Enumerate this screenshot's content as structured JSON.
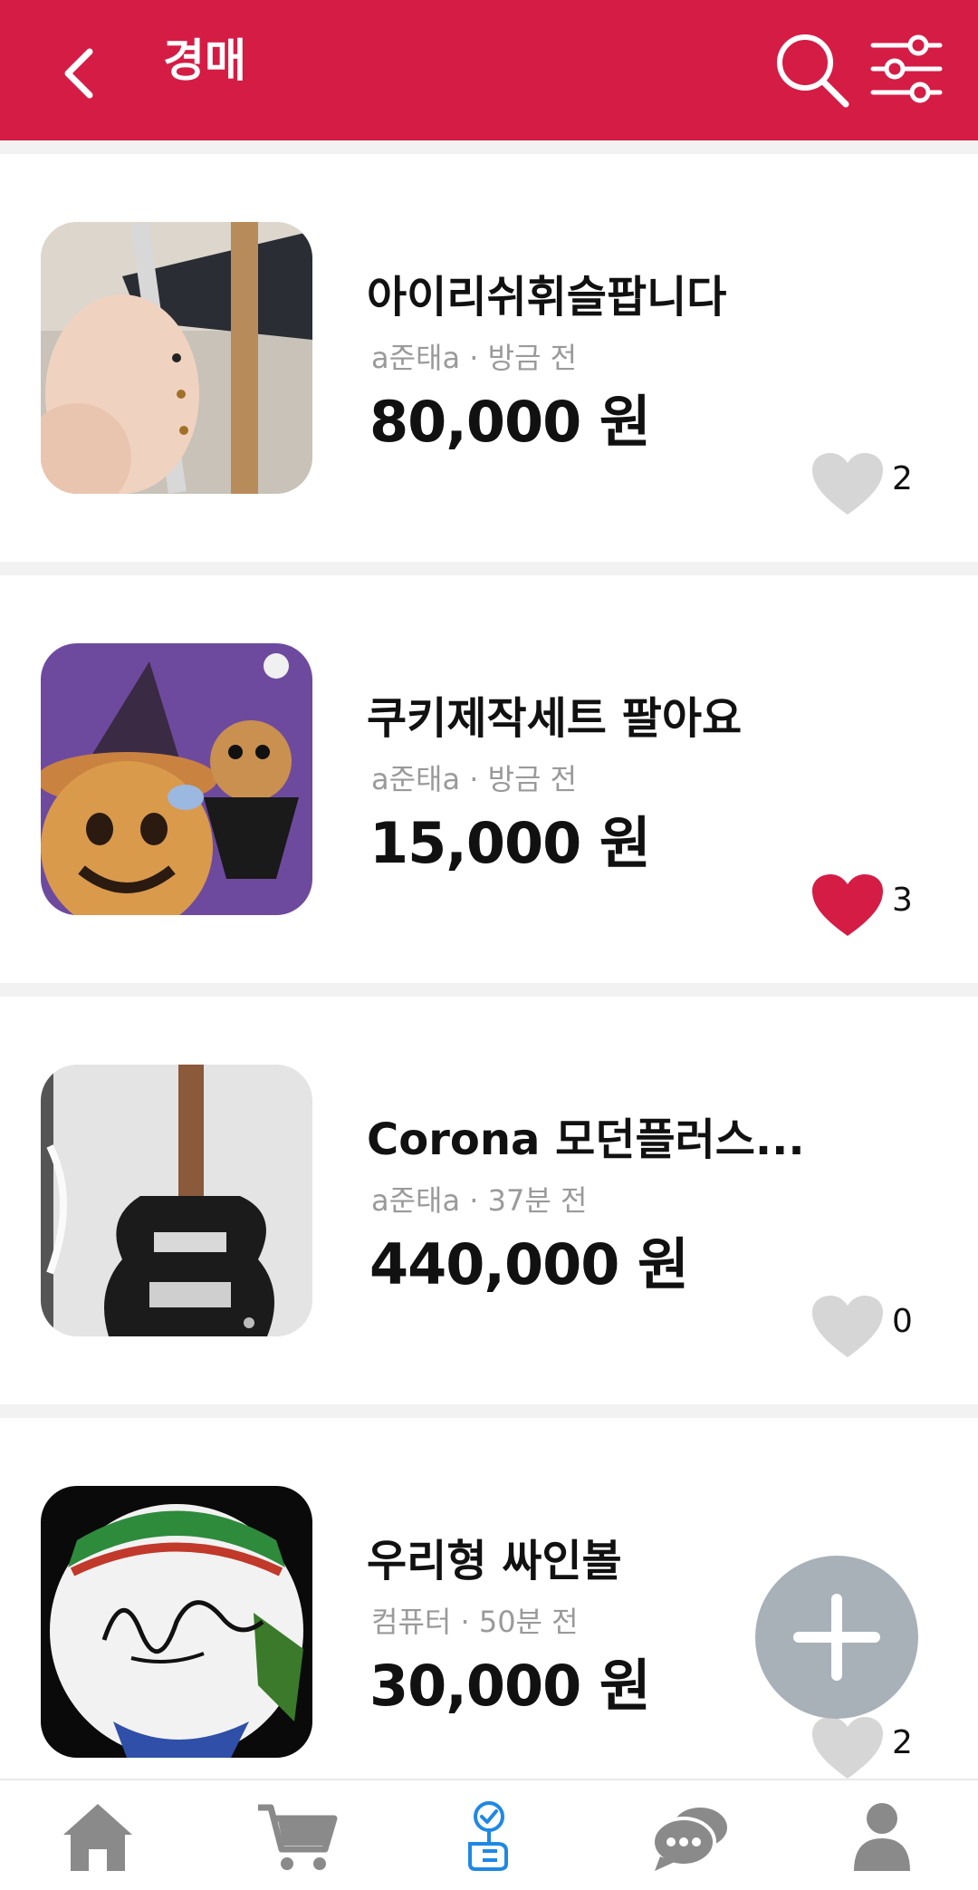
{
  "header": {
    "title": "경매",
    "back_icon": "chevron-left-icon",
    "search_icon": "search-icon",
    "filter_icon": "sliders-icon"
  },
  "items": [
    {
      "title": "아이리쉬휘슬팝니다",
      "meta": "a준태a · 방금 전",
      "price": "80,000 원",
      "likes": "2",
      "liked": false
    },
    {
      "title": "쿠키제작세트 팔아요",
      "meta": "a준태a · 방금 전",
      "price": "15,000 원",
      "likes": "3",
      "liked": true
    },
    {
      "title": "Corona 모던플러스...",
      "meta": "a준태a · 37분 전",
      "price": "440,000 원",
      "likes": "0",
      "liked": false
    },
    {
      "title": "우리형 싸인볼",
      "meta": "컴퓨터 · 50분 전",
      "price": "30,000 원",
      "likes": "2",
      "liked": false
    }
  ],
  "fab": {
    "icon": "plus-icon"
  },
  "bottom_nav": {
    "items": [
      {
        "icon": "home-icon",
        "active": false
      },
      {
        "icon": "cart-icon",
        "active": false
      },
      {
        "icon": "auction-icon",
        "active": true
      },
      {
        "icon": "chat-icon",
        "active": false
      },
      {
        "icon": "profile-icon",
        "active": false
      }
    ]
  },
  "colors": {
    "brand": "#d51c45",
    "like_active": "#d51c45",
    "like_inactive": "#d6d6d6",
    "nav_inactive": "#8a8a8a",
    "nav_active": "#1e88e5",
    "fab": "#a8b0b8"
  }
}
